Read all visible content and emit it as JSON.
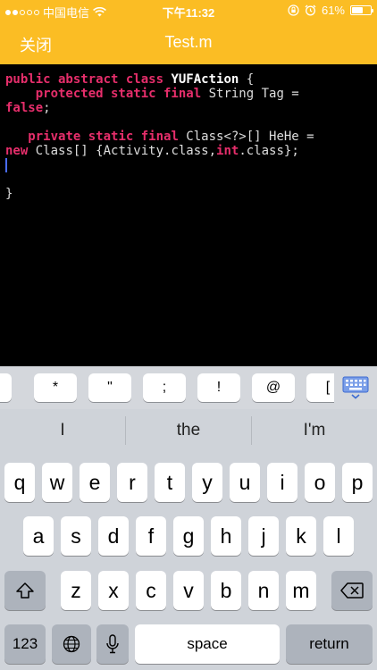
{
  "status": {
    "carrier": "中国电信",
    "time": "下午11:32",
    "battery": "61%",
    "battery_level": 0.61
  },
  "nav": {
    "close_label": "关闭",
    "title": "Test.m"
  },
  "code": {
    "l1_kw": "public abstract class ",
    "l1_cls": "YUFAction",
    "l1_rest": " {",
    "l2_indent": "    ",
    "l2_kw": "protected static final",
    "l2_rest": " String Tag =",
    "l3_kw": "false",
    "l3_rest": ";",
    "l5_indent": "   ",
    "l5_kw": "private static final",
    "l5_rest": " Class<?>[] HeHe =",
    "l6_kw": "new",
    "l6_mid": " Class[] {Activity.class,",
    "l6_kw2": "int",
    "l6_rest": ".class};",
    "l8": "}"
  },
  "accessory": {
    "keys": [
      "=",
      "*",
      "\"",
      ";",
      "!",
      "@",
      "["
    ]
  },
  "predictions": [
    "I",
    "the",
    "I'm"
  ],
  "keyboard": {
    "row1": [
      "q",
      "w",
      "e",
      "r",
      "t",
      "y",
      "u",
      "i",
      "o",
      "p"
    ],
    "row2": [
      "a",
      "s",
      "d",
      "f",
      "g",
      "h",
      "j",
      "k",
      "l"
    ],
    "row3": [
      "z",
      "x",
      "c",
      "v",
      "b",
      "n",
      "m"
    ],
    "numbers_label": "123",
    "space_label": "space",
    "return_label": "return"
  },
  "icons": {
    "wifi": "wifi-icon",
    "lock": "rotation-lock-icon",
    "alarm": "alarm-icon",
    "shift": "shift-icon",
    "delete": "delete-icon",
    "globe": "globe-icon",
    "mic": "microphone-icon",
    "keyboard_hide": "keyboard-hide-icon"
  },
  "colors": {
    "accent": "#fbbd24",
    "keyword": "#e62e6b",
    "cursor": "#4a6cf7"
  }
}
